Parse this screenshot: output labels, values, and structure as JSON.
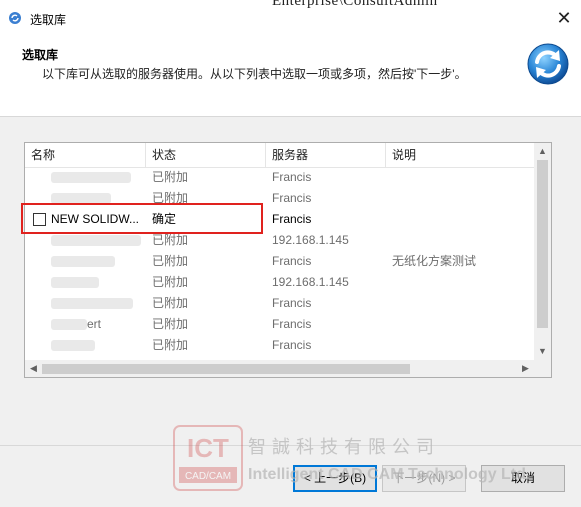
{
  "window": {
    "title": "选取库",
    "background_title_fragment": "Enterprise\\ConsultAdmin",
    "close_glyph": "✕"
  },
  "header": {
    "title": "选取库",
    "description": "以下库可从选取的服务器使用。从以下列表中选取一项或多项，然后按'下一步'。",
    "icon": "refresh-arrows-icon"
  },
  "list": {
    "columns": [
      "名称",
      "状态",
      "服务器",
      "说明"
    ],
    "rows": [
      {
        "name": "",
        "status": "已附加",
        "server": "Francis",
        "note": "",
        "checkbox": false,
        "blurred": true
      },
      {
        "name": "",
        "status": "已附加",
        "server": "Francis",
        "note": "",
        "checkbox": false,
        "blurred": true
      },
      {
        "name": "NEW SOLIDW...",
        "status": "确定",
        "server": "Francis",
        "note": "",
        "checkbox": true,
        "blurred": false
      },
      {
        "name": "",
        "status": "已附加",
        "server": "192.168.1.145",
        "note": "",
        "checkbox": false,
        "blurred": true
      },
      {
        "name": "",
        "status": "已附加",
        "server": "Francis",
        "note": "无纸化方案测试",
        "checkbox": false,
        "blurred": true
      },
      {
        "name": "",
        "status": "已附加",
        "server": "192.168.1.145",
        "note": "",
        "checkbox": false,
        "blurred": true
      },
      {
        "name": "",
        "status": "已附加",
        "server": "Francis",
        "note": "",
        "checkbox": false,
        "blurred": true
      },
      {
        "name": "ert",
        "status": "已附加",
        "server": "Francis",
        "note": "",
        "checkbox": false,
        "blurred": true
      },
      {
        "name": "",
        "status": "已附加",
        "server": "Francis",
        "note": "",
        "checkbox": false,
        "blurred": true
      }
    ]
  },
  "buttons": {
    "back": "< 上一步(B)",
    "next": "下一步(N) >",
    "cancel": "取消"
  },
  "watermark": {
    "logo_text": "ICT",
    "logo_sub": "CAD/CAM",
    "chinese": "智誠科技有限公司",
    "english": "Intelligent CAD CAM Technology Ltd."
  },
  "colors": {
    "highlight_border": "#e0221e",
    "primary_border": "#0078d7"
  }
}
